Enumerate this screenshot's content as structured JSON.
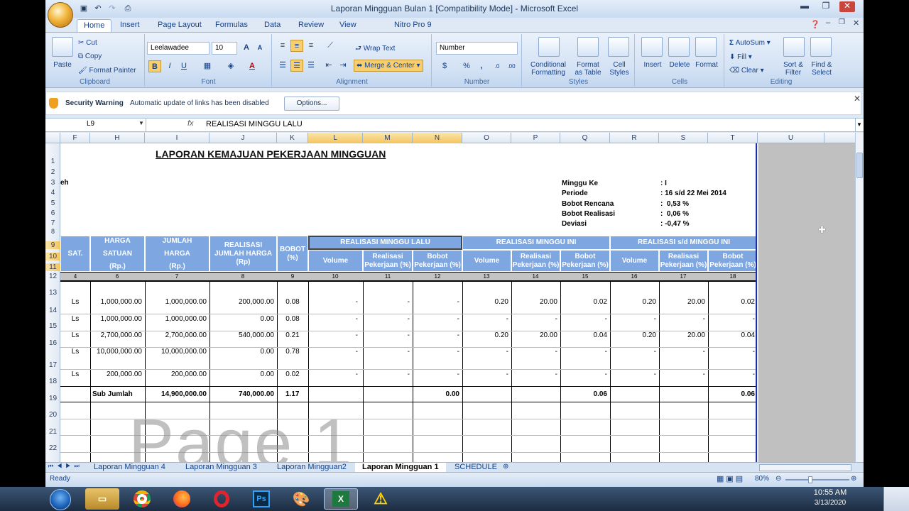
{
  "window": {
    "title": "Laporan Mingguan Bulan 1  [Compatibility Mode] - Microsoft Excel"
  },
  "tabs": [
    "Home",
    "Insert",
    "Page Layout",
    "Formulas",
    "Data",
    "Review",
    "View",
    "Nitro Pro 9"
  ],
  "clipboard": {
    "paste": "Paste",
    "cut": "Cut",
    "copy": "Copy",
    "format_painter": "Format Painter",
    "label": "Clipboard"
  },
  "font": {
    "name": "Leelawadee",
    "size": "10",
    "label": "Font",
    "bold": "B",
    "italic": "I",
    "underline": "U"
  },
  "alignment": {
    "wrap": "Wrap Text",
    "merge": "Merge & Center",
    "label": "Alignment"
  },
  "number": {
    "format": "Number",
    "currency": "$",
    "percent": "%",
    "comma": ",",
    "label": "Number"
  },
  "styles": {
    "conditional": "Conditional\nFormatting",
    "format_table": "Format\nas Table",
    "cell_styles": "Cell\nStyles",
    "label": "Styles"
  },
  "cells": {
    "insert": "Insert",
    "delete": "Delete",
    "format": "Format",
    "label": "Cells"
  },
  "editing": {
    "autosum": "AutoSum",
    "fill": "Fill",
    "clear": "Clear",
    "sort": "Sort &\nFilter",
    "find": "Find &\nSelect",
    "label": "Editing"
  },
  "security": {
    "title": "Security Warning",
    "message": "Automatic update of links has been disabled",
    "options": "Options..."
  },
  "formula_bar": {
    "name_box": "L9",
    "fx": "fx",
    "content": "REALISASI MINGGU LALU"
  },
  "columns": [
    "F",
    "H",
    "I",
    "J",
    "K",
    "L",
    "M",
    "N",
    "O",
    "P",
    "Q",
    "R",
    "S",
    "T",
    "U"
  ],
  "rows": [
    "1",
    "2",
    "3",
    "4",
    "5",
    "6",
    "7",
    "8",
    "9",
    "10",
    "11",
    "12",
    "13",
    "14",
    "15",
    "16",
    "17",
    "18",
    "19",
    "20",
    "21",
    "22"
  ],
  "report": {
    "title": "LAPORAN KEMAJUAN PEKERJAAN MINGGUAN",
    "left_fragment": "eh",
    "info": [
      {
        "k": "Minggu Ke",
        "v": ": I"
      },
      {
        "k": "Periode",
        "v": ": 16 s/d 22 Mei 2014"
      },
      {
        "k": "Bobot Rencana",
        "v": ":  0,53 %"
      },
      {
        "k": "Bobot Realisasi",
        "v": ":  0,06 %"
      },
      {
        "k": "Deviasi",
        "v": ": -0,47 %"
      }
    ]
  },
  "table_headers": {
    "sat": "SAT.",
    "harga": "HARGA\n\nSATUAN\n\n(Rp.)",
    "jumlah": "JUMLAH\n\nHARGA\n\n(Rp.)",
    "realisasi": "REALISASI\nJUMLAH HARGA\n(Rp)",
    "bobot": "BOBOT\n(%)",
    "lalu": "REALISASI MINGGU LALU",
    "ini": "REALISASI MINGGU INI",
    "sd": "REALISASI s/d MINGGU INI",
    "volume": "Volume",
    "realisasi_pek": "Realisasi\nPekerjaan (%)",
    "bobot_pek": "Bobot\nPekerjaan (%)",
    "col_numbers": [
      "4",
      "6",
      "7",
      "8",
      "9",
      "10",
      "11",
      "12",
      "13",
      "14",
      "15",
      "16",
      "17",
      "18"
    ]
  },
  "data_rows": [
    {
      "sat": "Ls",
      "harga": "1,000,000.00",
      "jumlah": "1,000,000.00",
      "real": "200,000.00",
      "bobot": "0.08",
      "l_vol": "-",
      "l_rp": "-",
      "l_bp": "-",
      "i_vol": "0.20",
      "i_rp": "20.00",
      "i_bp": "0.02",
      "s_vol": "0.20",
      "s_rp": "20.00",
      "s_bp": "0.02"
    },
    {
      "sat": "Ls",
      "harga": "1,000,000.00",
      "jumlah": "1,000,000.00",
      "real": "0.00",
      "bobot": "0.08",
      "l_vol": "-",
      "l_rp": "-",
      "l_bp": "-",
      "i_vol": "-",
      "i_rp": "-",
      "i_bp": "-",
      "s_vol": "-",
      "s_rp": "-",
      "s_bp": "-"
    },
    {
      "sat": "Ls",
      "harga": "2,700,000.00",
      "jumlah": "2,700,000.00",
      "real": "540,000.00",
      "bobot": "0.21",
      "l_vol": "-",
      "l_rp": "-",
      "l_bp": "-",
      "i_vol": "0.20",
      "i_rp": "20.00",
      "i_bp": "0.04",
      "s_vol": "0.20",
      "s_rp": "20.00",
      "s_bp": "0.04"
    },
    {
      "sat": "Ls",
      "harga": "10,000,000.00",
      "jumlah": "10,000,000.00",
      "real": "0.00",
      "bobot": "0.78",
      "l_vol": "-",
      "l_rp": "-",
      "l_bp": "-",
      "i_vol": "-",
      "i_rp": "-",
      "i_bp": "-",
      "s_vol": "-",
      "s_rp": "-",
      "s_bp": "-"
    },
    {
      "sat": "Ls",
      "harga": "200,000.00",
      "jumlah": "200,000.00",
      "real": "0.00",
      "bobot": "0.02",
      "l_vol": "-",
      "l_rp": "-",
      "l_bp": "-",
      "i_vol": "-",
      "i_rp": "-",
      "i_bp": "-",
      "s_vol": "-",
      "s_rp": "-",
      "s_bp": "-"
    }
  ],
  "subtotal": {
    "label": "Sub Jumlah",
    "jumlah": "14,900,000.00",
    "real": "740,000.00",
    "bobot": "1.17",
    "lalu": "0.00",
    "ini": "0.06",
    "sd": "0.06"
  },
  "watermark": "Page 1",
  "sheet_tabs": [
    "Laporan Mingguan 4",
    "Laporan Mingguan 3",
    "Laporan Mingguan2",
    "Laporan Mingguan 1",
    "SCHEDULE"
  ],
  "active_sheet": "Laporan Mingguan 1",
  "status": {
    "ready": "Ready",
    "zoom": "80%"
  },
  "taskbar": {
    "time": "10:55 AM",
    "date": "3/13/2020"
  }
}
